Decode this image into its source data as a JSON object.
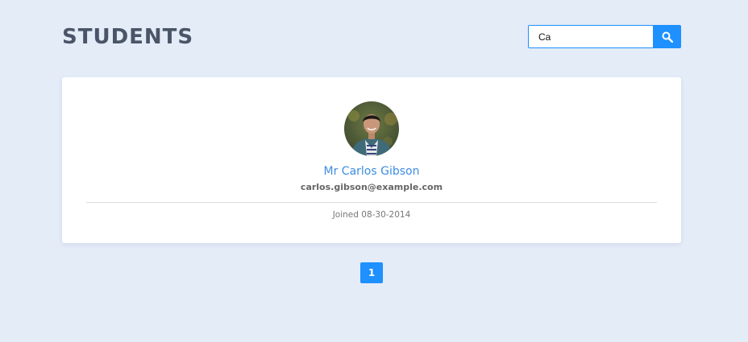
{
  "header": {
    "title": "STUDENTS"
  },
  "search": {
    "value": "Ca",
    "button_icon": "search-icon"
  },
  "student": {
    "name": "Mr Carlos Gibson",
    "email": "carlos.gibson@example.com",
    "joined": "Joined 08-30-2014",
    "avatar_icon": "person-photo"
  },
  "pagination": {
    "pages": [
      "1"
    ]
  },
  "colors": {
    "accent": "#1e90ff",
    "background": "#e4ecf8",
    "name": "#3d8de0",
    "title": "#4a5568"
  }
}
